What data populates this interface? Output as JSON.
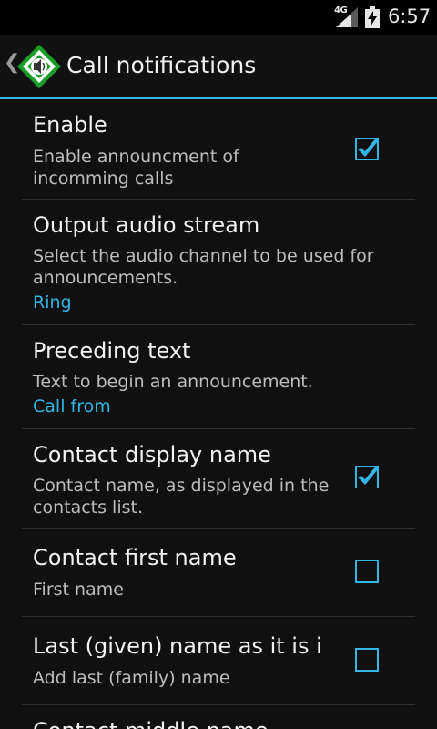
{
  "status_bar": {
    "network": "4G",
    "time": "6:57"
  },
  "action_bar": {
    "title": "Call notifications",
    "app_icon": "speaker-diamond-icon",
    "accent_color": "#33b5e5"
  },
  "preferences": [
    {
      "title": "Enable",
      "summary": "Enable announcment of incomming calls",
      "checked": true
    },
    {
      "title": "Output audio stream",
      "summary": "Select the audio channel to be used for announcements.",
      "value": "Ring"
    },
    {
      "title": "Preceding text",
      "summary": "Text to begin an announcement.",
      "value": "Call from"
    },
    {
      "title": "Contact display name",
      "summary": "Contact name, as displayed in the contacts list.",
      "checked": true
    },
    {
      "title": "Contact first name",
      "summary": "First name",
      "checked": false
    },
    {
      "title": "Last (given) name as it is i",
      "summary": "Add last (family) name",
      "checked": false
    },
    {
      "title": "Contact middle name"
    }
  ]
}
